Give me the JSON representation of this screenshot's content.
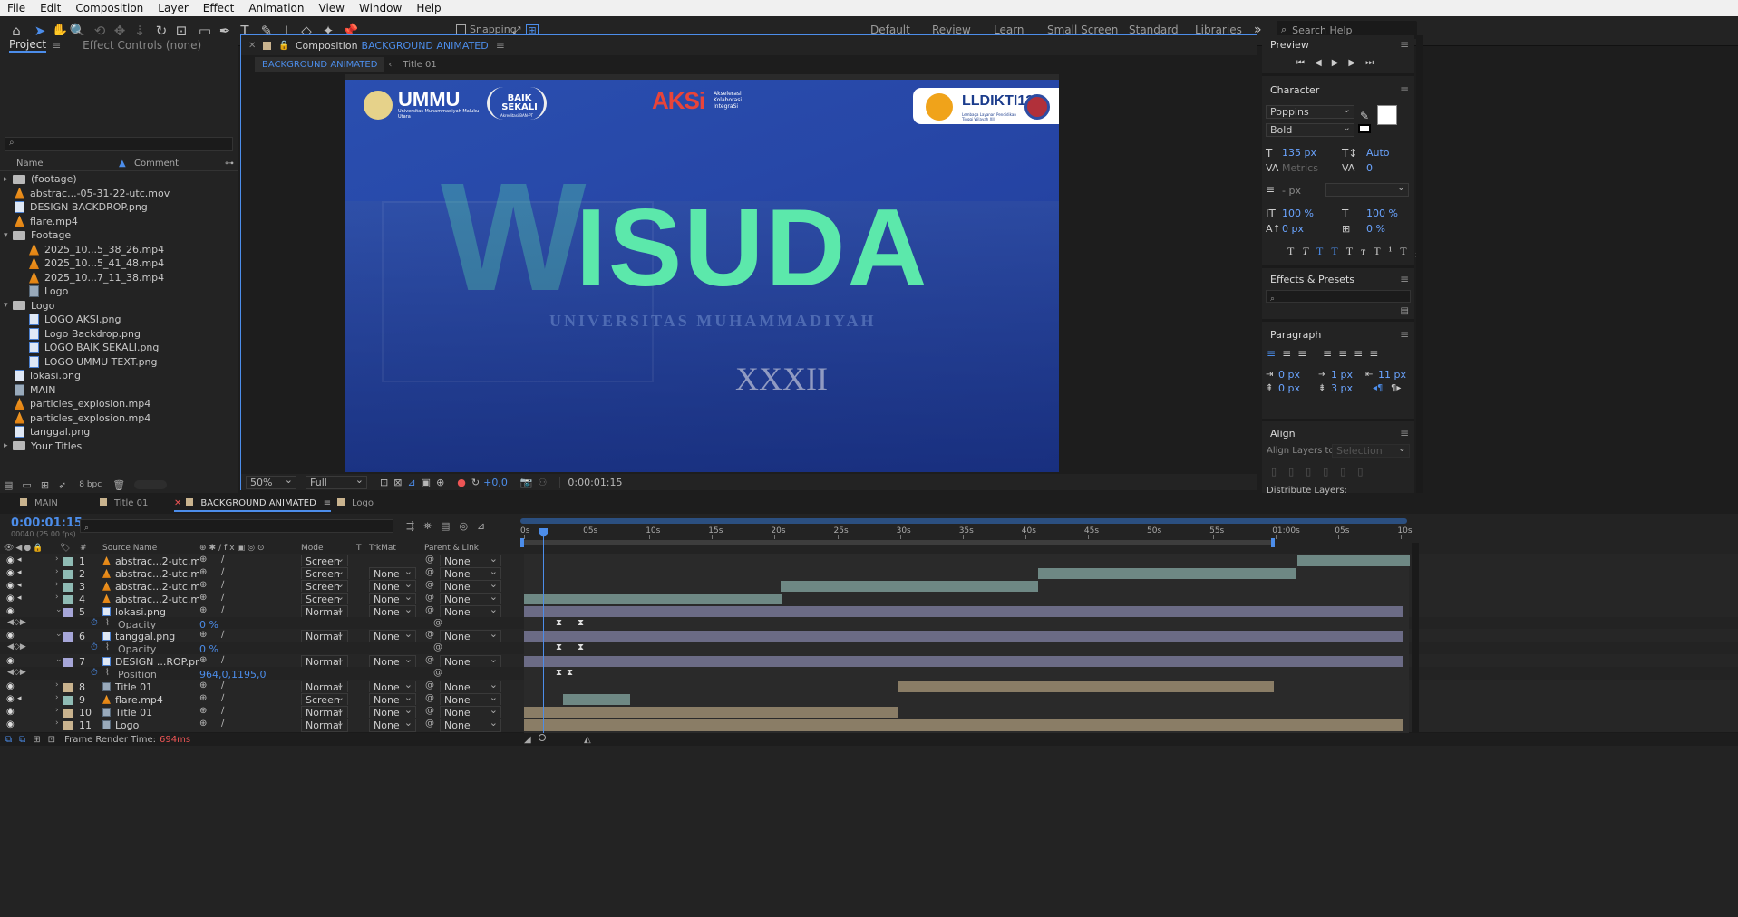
{
  "menu": [
    "File",
    "Edit",
    "Composition",
    "Layer",
    "Effect",
    "Animation",
    "View",
    "Window",
    "Help"
  ],
  "toolbar": {
    "snapping": "Snapping",
    "workspaces": [
      "Default",
      "Review",
      "Learn",
      "Small Screen",
      "Standard",
      "Libraries"
    ],
    "search_placeholder": "Search Help"
  },
  "project": {
    "tab_project": "Project",
    "tab_effect_controls": "Effect Controls (none)",
    "col_name": "Name",
    "col_comment": "Comment",
    "bpc": "8 bpc",
    "items": [
      {
        "label": "(footage)",
        "type": "folder",
        "indent": 0,
        "open": false
      },
      {
        "label": "abstrac...-05-31-22-utc.mov",
        "type": "mov",
        "indent": 0
      },
      {
        "label": "DESIGN BACKDROP.png",
        "type": "png",
        "indent": 0
      },
      {
        "label": "flare.mp4",
        "type": "mov",
        "indent": 0
      },
      {
        "label": "Footage",
        "type": "folder",
        "indent": 0,
        "open": true
      },
      {
        "label": "2025_10...5_38_26.mp4",
        "type": "mov",
        "indent": 1
      },
      {
        "label": "2025_10...5_41_48.mp4",
        "type": "mov",
        "indent": 1
      },
      {
        "label": "2025_10...7_11_38.mp4",
        "type": "mov",
        "indent": 1
      },
      {
        "label": "Logo",
        "type": "comp",
        "indent": 1
      },
      {
        "label": "Logo",
        "type": "folder",
        "indent": 0,
        "open": true
      },
      {
        "label": "LOGO AKSI.png",
        "type": "png",
        "indent": 1
      },
      {
        "label": "Logo Backdrop.png",
        "type": "png",
        "indent": 1
      },
      {
        "label": "LOGO BAIK SEKALI.png",
        "type": "png",
        "indent": 1
      },
      {
        "label": "LOGO UMMU TEXT.png",
        "type": "png",
        "indent": 1
      },
      {
        "label": "lokasi.png",
        "type": "png",
        "indent": 0
      },
      {
        "label": "MAIN",
        "type": "comp",
        "indent": 0
      },
      {
        "label": "particles_explosion.mp4",
        "type": "mov",
        "indent": 0
      },
      {
        "label": "particles_explosion.mp4",
        "type": "mov",
        "indent": 0
      },
      {
        "label": "tanggal.png",
        "type": "png",
        "indent": 0
      },
      {
        "label": "Your Titles",
        "type": "folder",
        "indent": 0,
        "open": false
      }
    ]
  },
  "composition": {
    "tab_prefix": "Composition",
    "name": "BACKGROUND ANIMATED",
    "breadcrumb_sub": "Title 01",
    "zoom": "50%",
    "resolution": "Full",
    "exposure": "+0,0",
    "timecode": "0:00:01:15",
    "art": {
      "title_rest": "ISUDA",
      "title_w": "W",
      "subtitle": "XXXII",
      "watermark": "UNIVERSITAS MUHAMMADIYAH",
      "logo_ummu": "UMMU",
      "logo_ummu_sub": "Universitas Muhammadiyah Maluku Utara",
      "logo_baik": "BAIK SEKALI",
      "logo_baik_sub": "Akreditasi BAN-PT",
      "logo_aksi": "AKSi",
      "logo_aksi_sub": "Akselerasi Kolaborasi IntegraSi",
      "logo_lldikti": "LLDIKTI12",
      "logo_lldikti_sub": "Lembaga Layanan Pendidikan Tinggi Wilayah XII"
    }
  },
  "preview": {
    "title": "Preview"
  },
  "character": {
    "title": "Character",
    "font": "Poppins",
    "style": "Bold",
    "size": "135 px",
    "leading": "Auto",
    "kerning": "Metrics",
    "tracking": "0",
    "stroke": "- px",
    "vscale": "100 %",
    "hscale": "100 %",
    "baseline": "0 px",
    "tsume": "0 %"
  },
  "effects": {
    "title": "Effects & Presets"
  },
  "paragraph": {
    "title": "Paragraph",
    "indent_left": "0 px",
    "indent_first": "1 px",
    "indent_right": "11 px",
    "space_before": "0 px",
    "space_after": "3 px"
  },
  "align": {
    "title": "Align",
    "align_layers_to": "Align Layers to:",
    "selection": "Selection",
    "distribute": "Distribute Layers:"
  },
  "timeline": {
    "tabs": [
      "MAIN",
      "Title 01",
      "BACKGROUND ANIMATED",
      "Logo"
    ],
    "timecode": "0:00:01:15",
    "frame": "00040 (25.00 fps)",
    "cols": {
      "num": "#",
      "source": "Source Name",
      "mode": "Mode",
      "t": "T",
      "trkmat": "TrkMat",
      "parent": "Parent & Link"
    },
    "ruler": [
      "0s",
      "05s",
      "10s",
      "15s",
      "20s",
      "25s",
      "30s",
      "35s",
      "40s",
      "45s",
      "50s",
      "55s",
      "01:00s",
      "05s",
      "10s"
    ],
    "layers": [
      {
        "num": "1",
        "name": "abstrac...2-utc.mov",
        "type": "mov",
        "color": "#8fbbb4",
        "mode": "Screen",
        "trkmat": "",
        "parent": "None",
        "bar": [
          1431,
          1555
        ],
        "barcolor": "#6e8884"
      },
      {
        "num": "2",
        "name": "abstrac...2-utc.mov",
        "type": "mov",
        "color": "#8fbbb4",
        "mode": "Screen",
        "trkmat": "None",
        "parent": "None",
        "bar": [
          1145,
          1429
        ],
        "barcolor": "#6e8884"
      },
      {
        "num": "3",
        "name": "abstrac...2-utc.mov",
        "type": "mov",
        "color": "#8fbbb4",
        "mode": "Screen",
        "trkmat": "None",
        "parent": "None",
        "bar": [
          861,
          1145
        ],
        "barcolor": "#6e8884"
      },
      {
        "num": "4",
        "name": "abstrac...2-utc.mov",
        "type": "mov",
        "color": "#8fbbb4",
        "mode": "Screen",
        "trkmat": "None",
        "parent": "None",
        "bar": [
          578,
          862
        ],
        "barcolor": "#6e8884"
      },
      {
        "num": "5",
        "name": "lokasi.png",
        "type": "png",
        "color": "#a6a6d8",
        "mode": "Normal",
        "trkmat": "None",
        "parent": "None",
        "bar": [
          578,
          1548
        ],
        "barcolor": "#6b6b85",
        "open": true
      },
      {
        "sub": true,
        "prop": "Opacity",
        "value": "0 %",
        "keys": [
          616,
          640
        ]
      },
      {
        "num": "6",
        "name": "tanggal.png",
        "type": "png",
        "color": "#a6a6d8",
        "mode": "Normal",
        "trkmat": "None",
        "parent": "None",
        "bar": [
          578,
          1548
        ],
        "barcolor": "#6b6b85",
        "open": true
      },
      {
        "sub": true,
        "prop": "Opacity",
        "value": "0 %",
        "keys": [
          616,
          640
        ]
      },
      {
        "num": "7",
        "name": "DESIGN ...ROP.png",
        "type": "png",
        "color": "#a6a6d8",
        "mode": "Normal",
        "trkmat": "None",
        "parent": "None",
        "bar": [
          578,
          1548
        ],
        "barcolor": "#6b6b85",
        "open": true
      },
      {
        "sub": true,
        "prop": "Position",
        "value": "964,0,1195,0",
        "keys": [
          616,
          628
        ]
      },
      {
        "num": "8",
        "name": "Title 01",
        "type": "comp",
        "color": "#c9b38e",
        "mode": "Normal",
        "trkmat": "None",
        "parent": "None",
        "bar": [
          991,
          1405
        ],
        "barcolor": "#8a7d66"
      },
      {
        "num": "9",
        "name": "flare.mp4",
        "type": "mov",
        "color": "#8fbbb4",
        "mode": "Screen",
        "trkmat": "None",
        "parent": "None",
        "bar": [
          621,
          695
        ],
        "barcolor": "#6e8884"
      },
      {
        "num": "10",
        "name": "Title 01",
        "type": "comp",
        "color": "#c9b38e",
        "mode": "Normal",
        "trkmat": "None",
        "parent": "None",
        "bar": [
          578,
          991
        ],
        "barcolor": "#8a7d66"
      },
      {
        "num": "11",
        "name": "Logo",
        "type": "comp",
        "color": "#c9b38e",
        "mode": "Normal",
        "trkmat": "None",
        "parent": "None",
        "bar": [
          578,
          1548
        ],
        "barcolor": "#8a7d66"
      }
    ],
    "render_label": "Frame Render Time:",
    "render_value": "694ms"
  }
}
